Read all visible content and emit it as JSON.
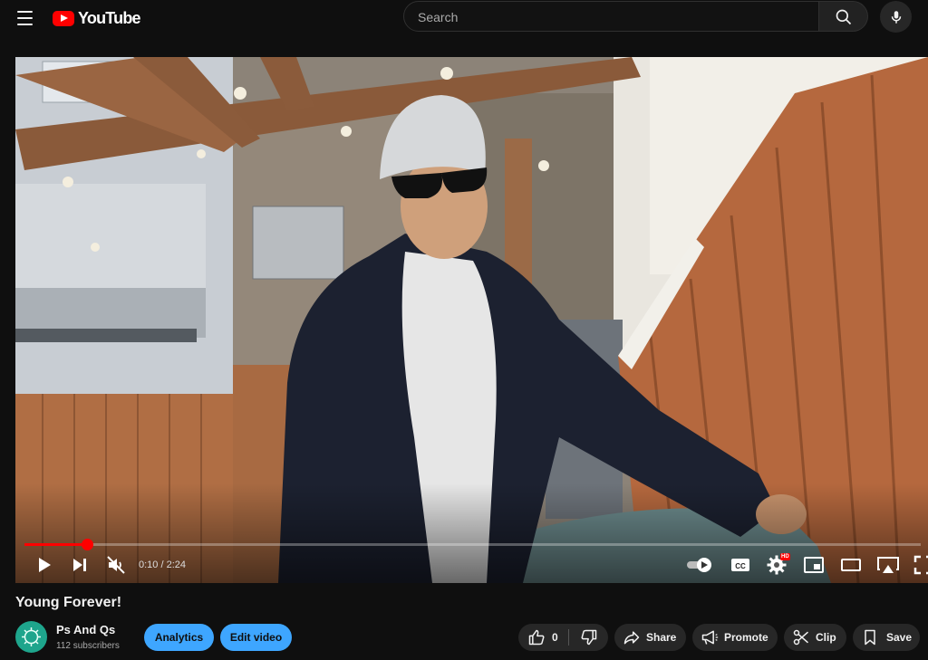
{
  "header": {
    "logo_text": "YouTube",
    "search_placeholder": "Search"
  },
  "player": {
    "current_time": "0:10",
    "duration": "2:24",
    "time_display": "0:10 / 2:24",
    "progress_fraction": 0.0694,
    "muted": true,
    "autoplay_on": true,
    "quality_badge": "HD",
    "accent_color": "#ff0000"
  },
  "video": {
    "title": "Young Forever!"
  },
  "channel": {
    "name": "Ps And Qs",
    "subscribers": "112 subscribers",
    "avatar_color": "#1ea58c"
  },
  "actions": {
    "analytics": "Analytics",
    "edit_video": "Edit video",
    "likes": "0",
    "share": "Share",
    "promote": "Promote",
    "clip": "Clip",
    "save": "Save",
    "button_accent": "#3ea6ff"
  }
}
